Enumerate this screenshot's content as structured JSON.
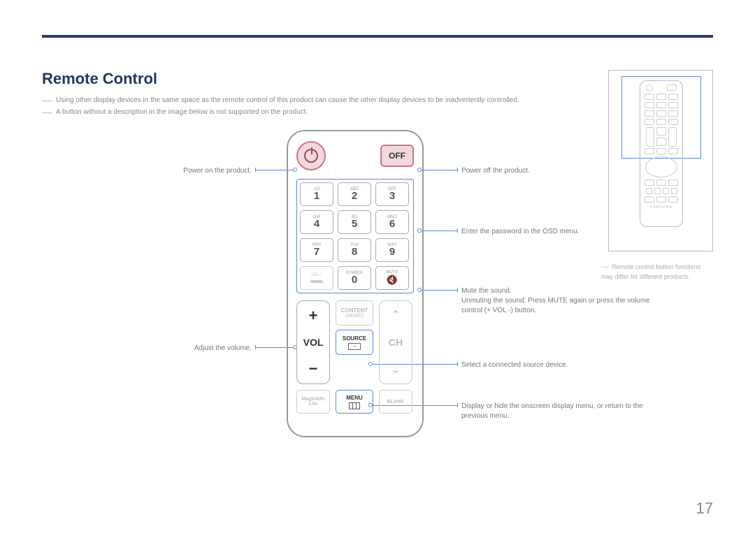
{
  "heading": "Remote Control",
  "notes": [
    "Using other display devices in the same space as the remote control of this product can cause the other display devices to be inadvertently controlled.",
    "A button without a description in the image below is not supported on the product."
  ],
  "remote": {
    "off_label": "OFF",
    "keypad": [
      [
        {
          "sub": ".QZ",
          "d": "1"
        },
        {
          "sub": "ABC",
          "d": "2"
        },
        {
          "sub": "DEF",
          "d": "3"
        }
      ],
      [
        {
          "sub": "GHI",
          "d": "4"
        },
        {
          "sub": "JKL",
          "d": "5"
        },
        {
          "sub": "MNO",
          "d": "6"
        }
      ],
      [
        {
          "sub": "PRS",
          "d": "7"
        },
        {
          "sub": "TUV",
          "d": "8"
        },
        {
          "sub": "WXY",
          "d": "9"
        }
      ]
    ],
    "del_label": "DEL/-",
    "symbol_label": "SYMBOL",
    "zero": "0",
    "mute_label": "MUTE",
    "vol_label": "VOL",
    "ch_label": "CH",
    "content_label": "CONTENT",
    "home_label": "(HOME)",
    "source_label": "SOURCE",
    "menu_label": "MENU",
    "magicinfo_label": "MagicInfo",
    "magicinfo_sub": "Lite",
    "blank_label": "BLANK"
  },
  "callouts": {
    "power_on": "Power on the product.",
    "volume": "Adjust the volume.",
    "power_off": "Power off the product.",
    "password": "Enter the password in the OSD menu.",
    "mute1": "Mute the sound.",
    "mute2": "Unmuting the sound: Press MUTE again or press the volume control (+ VOL -) button.",
    "source": "Select a connected source device.",
    "menu": "Display or hide the onscreen display menu, or return to the previous menu."
  },
  "side_note": "Remote control button functions may differ for different products.",
  "brand": "SAMSUNG",
  "page_number": "17"
}
